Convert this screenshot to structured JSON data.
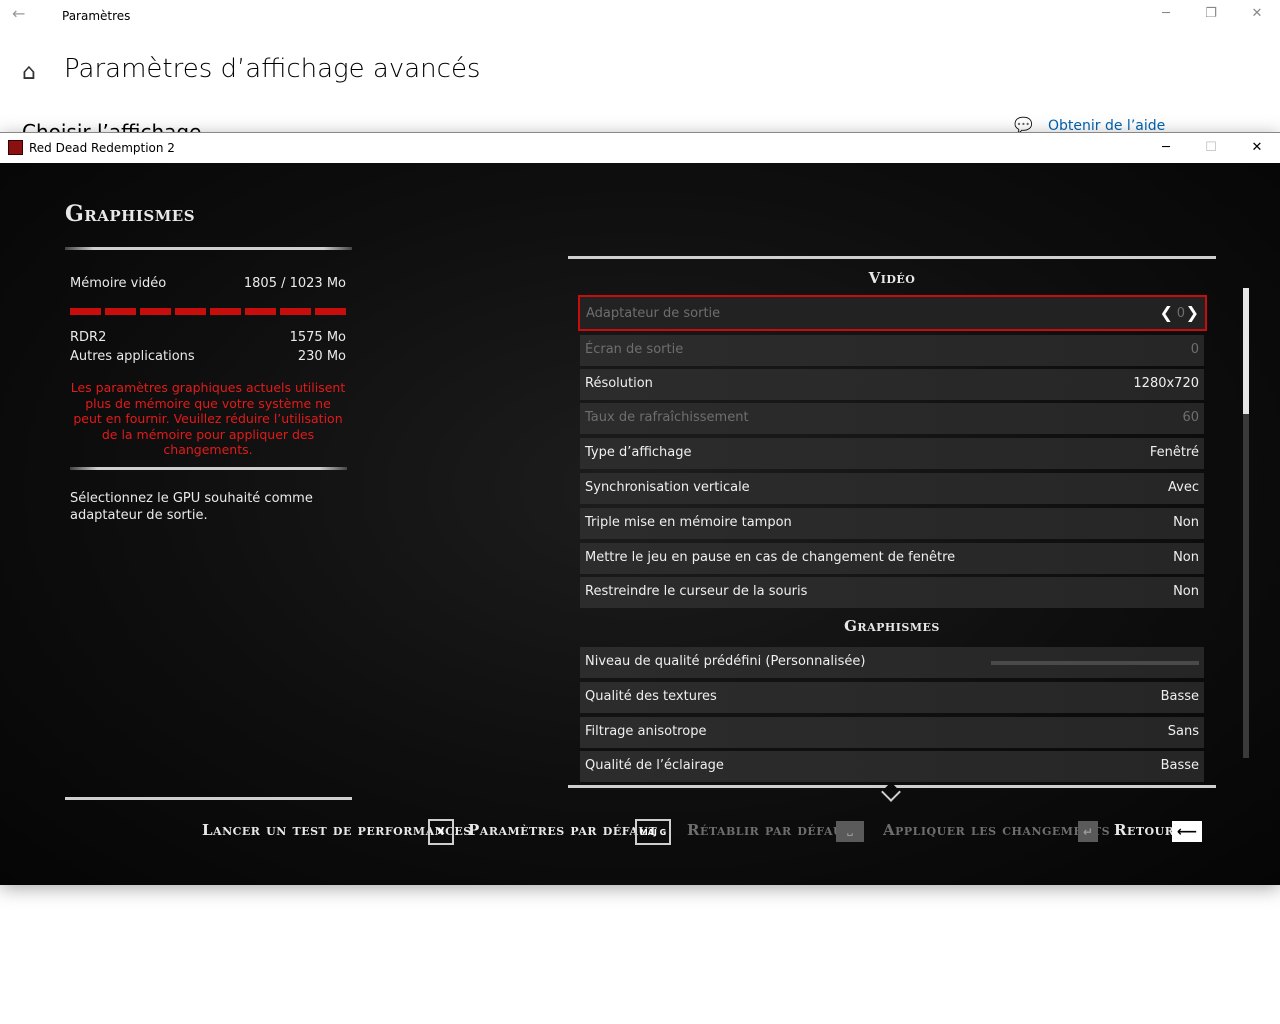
{
  "settings": {
    "app_title": "Paramètres",
    "page_title": "Paramètres d’affichage avancés",
    "partial_subtitle": "Choisir l’affichage",
    "help_link": "Obtenir de l’aide",
    "icons": {
      "back": "back-arrow-icon",
      "home": "home-icon",
      "help": "help-chat-icon"
    }
  },
  "rdr": {
    "window_title": "Red Dead Redemption 2",
    "left": {
      "title": "Graphismes",
      "memory_label": "Mémoire vidéo",
      "memory_value": "1805 / 1023 Mo",
      "memory_usage_fraction": 1.0,
      "rdr2_label": "RDR2",
      "rdr2_value": "1575 Mo",
      "other_label": "Autres applications",
      "other_value": "230 Mo",
      "warning": "Les paramètres graphiques actuels utilisent plus de mémoire que votre système ne peut en fournir. Veuillez réduire l’utilisation de la mémoire pour appliquer des changements.",
      "description": "Sélectionnez le GPU souhaité comme adaptateur de sortie."
    },
    "sections": {
      "video": "Vidéo",
      "graphics": "Graphismes"
    },
    "options": {
      "adapter": {
        "label": "Adaptateur de sortie",
        "value": "0"
      },
      "screen": {
        "label": "Écran de sortie",
        "value": "0"
      },
      "resolution": {
        "label": "Résolution",
        "value": "1280x720"
      },
      "refresh": {
        "label": "Taux de rafraîchissement",
        "value": "60"
      },
      "display_type": {
        "label": "Type d’affichage",
        "value": "Fenêtré"
      },
      "vsync": {
        "label": "Synchronisation verticale",
        "value": "Avec"
      },
      "triple_buffer": {
        "label": "Triple mise en mémoire tampon",
        "value": "Non"
      },
      "pause": {
        "label": "Mettre le jeu en pause en cas de changement de fenêtre",
        "value": "Non"
      },
      "cursor": {
        "label": "Restreindre le curseur de la souris",
        "value": "Non"
      },
      "quality_preset": {
        "label": "Niveau de qualité prédéfini  (Personnalisée)"
      },
      "textures": {
        "label": "Qualité des textures",
        "value": "Basse"
      },
      "anisotropic": {
        "label": "Filtrage anisotrope",
        "value": "Sans"
      },
      "lighting": {
        "label": "Qualité de l’éclairage",
        "value": "Basse"
      }
    },
    "actions": {
      "benchmark": {
        "label": "Lancer un test de performances",
        "key": "X"
      },
      "default_settings": {
        "label": "Paramètres par défaut",
        "key": "MAJ G"
      },
      "restore_default": {
        "label": "Rétablir par défaut",
        "key": "␣"
      },
      "apply": {
        "label": "Appliquer les changements",
        "key": "↵"
      },
      "back": {
        "label": "Retour",
        "key": "⟵"
      }
    },
    "colors": {
      "accent_red": "#c80d0d",
      "warning_red": "#e31a1a"
    }
  }
}
